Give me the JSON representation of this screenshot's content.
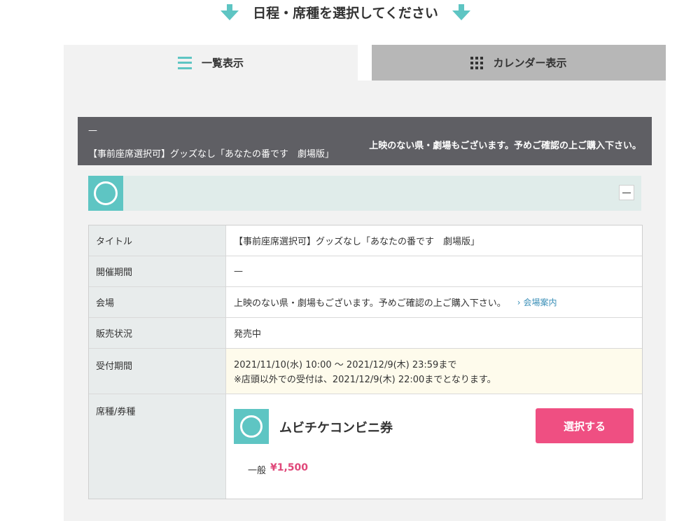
{
  "heading": {
    "text": "日程・席種を選択してください"
  },
  "tabs": [
    {
      "label": "一覧表示",
      "icon": "list-icon",
      "active": true
    },
    {
      "label": "カレンダー表示",
      "icon": "grid-icon",
      "active": false
    }
  ],
  "event": {
    "dash": "—",
    "title": "【事前座席選択可】グッズなし「あなたの番です　劇場版」",
    "note": "上映のない県・劇場もございます。予めご確認の上ご購入下さい。"
  },
  "date_bar": {
    "collapse_label": "—"
  },
  "table": {
    "rows": [
      {
        "label": "タイトル",
        "value": "【事前座席選択可】グッズなし「あなたの番です　劇場版」"
      },
      {
        "label": "開催期間",
        "value": "—"
      },
      {
        "label": "会場",
        "value": "上映のない県・劇場もございます。予めご確認の上ご購入下さい。",
        "link": "会場案内"
      },
      {
        "label": "販売状況",
        "value": "発売中"
      },
      {
        "label": "受付期間",
        "line1": "2021/11/10(水) 10:00 ～ 2021/12/9(木) 23:59まで",
        "line2": "※店頭以外での受付は、2021/12/9(木) 22:00までとなります。"
      },
      {
        "label": "席種/券種"
      }
    ]
  },
  "ticket": {
    "name": "ムビチケコンビニ券",
    "select_label": "選択する",
    "price_label": "一般",
    "price_value": "¥1,500"
  },
  "colors": {
    "accent": "#5ec5c3",
    "header_bg": "#5f5f64",
    "select_button": "#ef4f82",
    "price": "#e0487a",
    "link": "#3a8fb7"
  }
}
